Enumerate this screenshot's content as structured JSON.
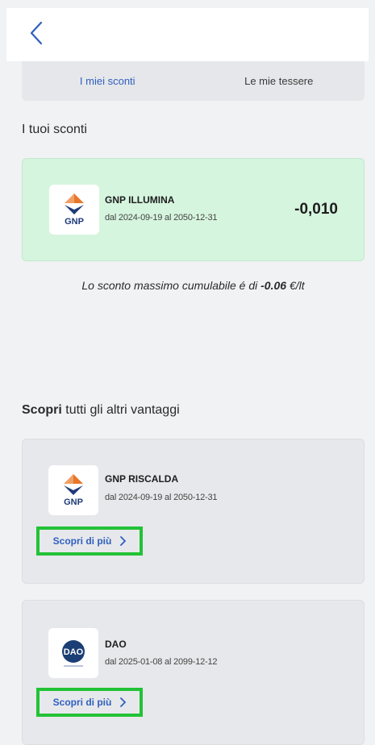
{
  "tabs": [
    {
      "label": "I miei sconti",
      "active": true
    },
    {
      "label": "Le mie tessere",
      "active": false
    }
  ],
  "sections": {
    "my_discounts_title": "I tuoi sconti",
    "discover_bold": "Scopri",
    "discover_rest": "tutti gli altri vantaggi"
  },
  "active_discount": {
    "name": "GNP ILLUMINA",
    "dates": "dal 2024-09-19 al 2050-12-31",
    "amount": "-0,010",
    "logo": "gnp-logo"
  },
  "note": {
    "prefix": "Lo sconto massimo cumulabile é di ",
    "value": "-0.06",
    "suffix": " €/lt"
  },
  "offers": [
    {
      "name": "GNP RISCALDA",
      "dates": "dal 2024-09-19 al 2050-12-31",
      "cta": "Scopri di più",
      "logo": "gnp-logo"
    },
    {
      "name": "DAO",
      "dates": "dal 2025-01-08 al 2099-12-12",
      "cta": "Scopri di più",
      "logo": "dao-logo"
    }
  ],
  "colors": {
    "accent": "#2f5fbf",
    "active_card": "#d6f5de",
    "highlight": "#22c236",
    "gnp_orange": "#e8772a",
    "gnp_navy": "#1f3a78",
    "dao_navy": "#1b3e74"
  },
  "icons": {
    "back": "chevron-left-icon",
    "cta": "chevron-right-icon"
  }
}
